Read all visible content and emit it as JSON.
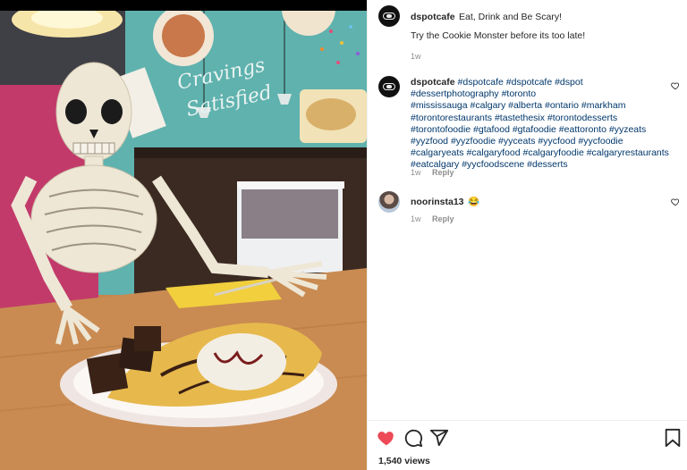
{
  "post": {
    "username": "dspotcafe",
    "caption": "Eat, Drink and Be Scary!",
    "caption_line2": "Try the Cookie Monster before its too late!",
    "age": "1w",
    "photo_wall_text": "Cravings Satisfied"
  },
  "comments": [
    {
      "username": "dspotcafe",
      "hashtags_lines": [
        "#dspotcafe #dspotcafe #dspot #dessertphotography #toronto",
        "#mississauga #calgary #alberta #ontario #markham",
        "#torontorestaurants #tastethesix #torontodesserts",
        "#torontofoodie #gtafood #gtafoodie #eattoronto #yyzeats",
        "#yyzfood #yyzfoodie #yyceats #yycfood #yycfoodie",
        "#calgaryeats #calgaryfood #calgaryfoodie #calgaryrestaurants",
        "#eatcalgary #yycfoodscene #desserts"
      ],
      "age": "1w",
      "reply_label": "Reply"
    },
    {
      "username": "noorinsta13",
      "emoji": "😂",
      "age": "1w",
      "reply_label": "Reply"
    }
  ],
  "icons": {
    "like": "heart-filled-icon",
    "comment": "comment-icon",
    "share": "share-icon",
    "save": "bookmark-icon"
  },
  "colors": {
    "like_red": "#ed4956",
    "hashtag_blue": "#00376b",
    "meta_gray": "#8e8e8e"
  },
  "views_label": "1,540 views"
}
